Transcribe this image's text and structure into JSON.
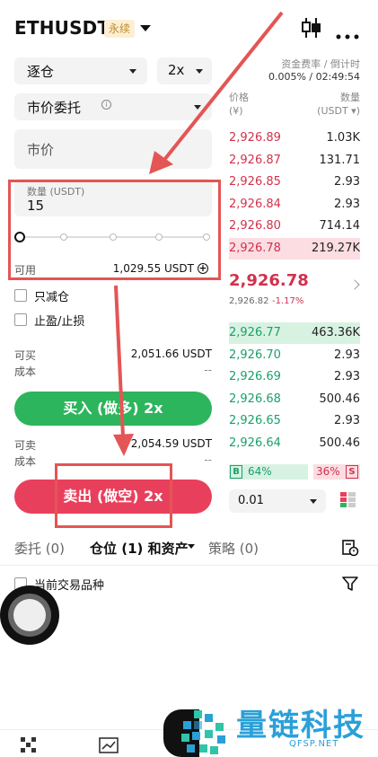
{
  "header": {
    "symbol": "ETHUSDT",
    "badge": "永续",
    "funding_label": "资金费率 / 倒计时",
    "funding_value": "0.005% / 02:49:54"
  },
  "form": {
    "margin_mode": "逐仓",
    "leverage": "2x",
    "order_type": "市价委托",
    "price_placeholder": "市价",
    "quantity_label": "数量 (USDT)",
    "quantity_value": "15",
    "slider_percent": 0,
    "available_label": "可用",
    "available_value": "1,029.55 USDT",
    "reduce_only": "只减仓",
    "tp_sl": "止盈/止损",
    "can_buy_label": "可买",
    "can_buy_value": "2,051.66 USDT",
    "cost_label": "成本",
    "cost_value": "--",
    "buy_button": "买入 (做多) 2x",
    "can_sell_label": "可卖",
    "can_sell_value": "2,054.59 USDT",
    "cost2_label": "成本",
    "cost2_value": "--",
    "sell_button": "卖出 (做空) 2x"
  },
  "orderbook": {
    "price_header": "价格",
    "price_unit": "(¥)",
    "qty_header": "数量",
    "qty_unit": "(USDT ▾)",
    "asks": [
      {
        "price": "2,926.89",
        "qty": "1.03K"
      },
      {
        "price": "2,926.87",
        "qty": "131.71"
      },
      {
        "price": "2,926.85",
        "qty": "2.93"
      },
      {
        "price": "2,926.84",
        "qty": "2.93"
      },
      {
        "price": "2,926.80",
        "qty": "714.14"
      },
      {
        "price": "2,926.78",
        "qty": "219.27K"
      }
    ],
    "last_price": "2,926.78",
    "mark_price": "2,926.82",
    "change": "-1.17%",
    "bids": [
      {
        "price": "2,926.77",
        "qty": "463.36K"
      },
      {
        "price": "2,926.70",
        "qty": "2.93"
      },
      {
        "price": "2,926.69",
        "qty": "2.93"
      },
      {
        "price": "2,926.68",
        "qty": "500.46"
      },
      {
        "price": "2,926.65",
        "qty": "2.93"
      },
      {
        "price": "2,926.64",
        "qty": "500.46"
      }
    ],
    "buy_letter": "B",
    "buy_ratio": "64%",
    "sell_ratio": "36%",
    "sell_letter": "S",
    "precision": "0.01"
  },
  "tabs": {
    "orders": "委托 (0)",
    "positions": "仓位 (1) 和资产",
    "strategy": "策略 (0)"
  },
  "filter": {
    "current_symbol": "当前交易品种"
  },
  "watermark": {
    "title": "量链科技",
    "url": "QFSP.NET"
  },
  "colors": {
    "buy": "#2db55d",
    "sell": "#e8405c",
    "annotation": "#e45555"
  }
}
